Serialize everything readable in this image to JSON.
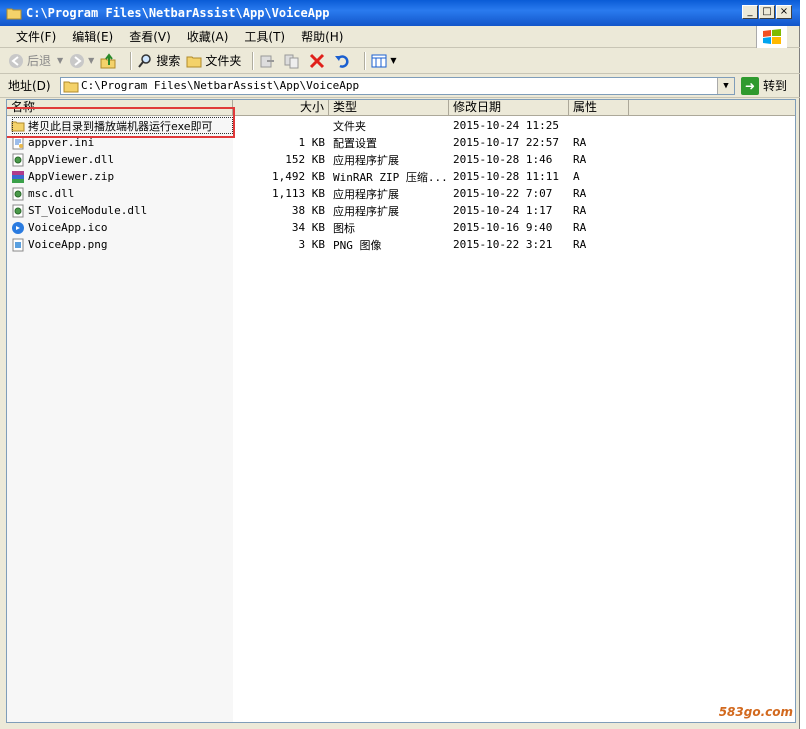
{
  "window": {
    "title": "C:\\Program Files\\NetbarAssist\\App\\VoiceApp"
  },
  "menu": [
    "文件(F)",
    "编辑(E)",
    "查看(V)",
    "收藏(A)",
    "工具(T)",
    "帮助(H)"
  ],
  "toolbar": {
    "back": "后退",
    "search": "搜索",
    "folders": "文件夹"
  },
  "address": {
    "label": "地址(D)",
    "path": "C:\\Program Files\\NetbarAssist\\App\\VoiceApp",
    "go": "转到"
  },
  "columns": [
    "名称",
    "大小",
    "类型",
    "修改日期",
    "属性"
  ],
  "files": [
    {
      "name": "拷贝此目录到播放端机器运行exe即可",
      "size": "",
      "type": "文件夹",
      "date": "2015-10-24 11:25",
      "attr": "",
      "icon": "folder-icon"
    },
    {
      "name": "appver.ini",
      "size": "1 KB",
      "type": "配置设置",
      "date": "2015-10-17 22:57",
      "attr": "RA",
      "icon": "ini-file-icon"
    },
    {
      "name": "AppViewer.dll",
      "size": "152 KB",
      "type": "应用程序扩展",
      "date": "2015-10-28 1:46",
      "attr": "RA",
      "icon": "dll-file-icon"
    },
    {
      "name": "AppViewer.zip",
      "size": "1,492 KB",
      "type": "WinRAR ZIP 压缩...",
      "date": "2015-10-28 11:11",
      "attr": "A",
      "icon": "winrar-icon"
    },
    {
      "name": "msc.dll",
      "size": "1,113 KB",
      "type": "应用程序扩展",
      "date": "2015-10-22 7:07",
      "attr": "RA",
      "icon": "dll-file-icon"
    },
    {
      "name": "ST_VoiceModule.dll",
      "size": "38 KB",
      "type": "应用程序扩展",
      "date": "2015-10-24 1:17",
      "attr": "RA",
      "icon": "dll-file-icon"
    },
    {
      "name": "VoiceApp.ico",
      "size": "34 KB",
      "type": "图标",
      "date": "2015-10-16 9:40",
      "attr": "RA",
      "icon": "ico-file-icon"
    },
    {
      "name": "VoiceApp.png",
      "size": "3 KB",
      "type": "PNG 图像",
      "date": "2015-10-22 3:21",
      "attr": "RA",
      "icon": "png-file-icon"
    }
  ],
  "watermark": "583go.com"
}
